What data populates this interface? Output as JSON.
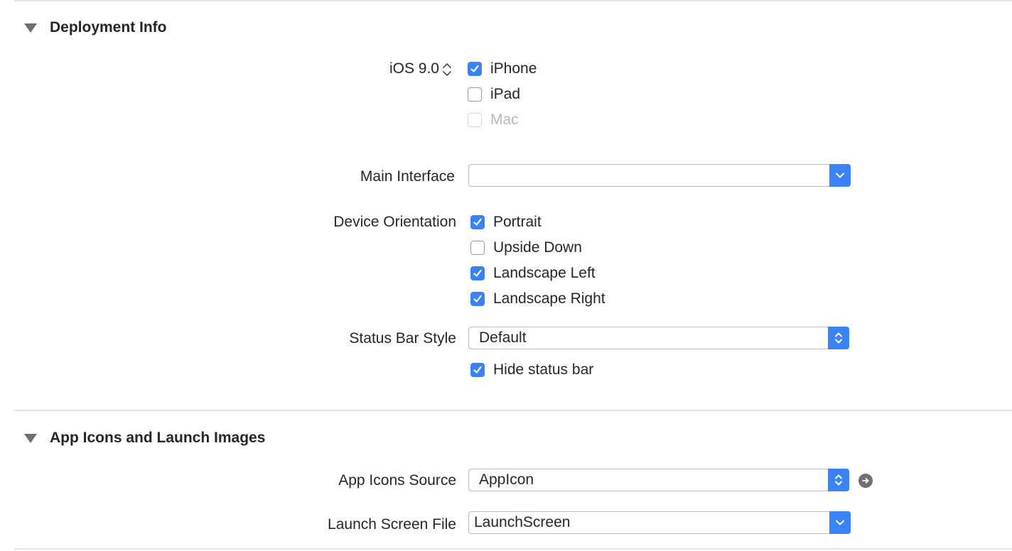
{
  "deployment": {
    "title": "Deployment Info",
    "ios_version": "iOS 9.0",
    "devices": [
      {
        "label": "iPhone",
        "checked": true,
        "enabled": true
      },
      {
        "label": "iPad",
        "checked": false,
        "enabled": true
      },
      {
        "label": "Mac",
        "checked": false,
        "enabled": false
      }
    ],
    "main_interface_label": "Main Interface",
    "main_interface_value": "",
    "orientation_label": "Device Orientation",
    "orientations": [
      {
        "label": "Portrait",
        "checked": true
      },
      {
        "label": "Upside Down",
        "checked": false
      },
      {
        "label": "Landscape Left",
        "checked": true
      },
      {
        "label": "Landscape Right",
        "checked": true
      }
    ],
    "status_bar_label": "Status Bar Style",
    "status_bar_value": "Default",
    "hide_status_bar_label": "Hide status bar",
    "hide_status_bar_checked": true
  },
  "app_icons": {
    "title": "App Icons and Launch Images",
    "icons_source_label": "App Icons Source",
    "icons_source_value": "AppIcon",
    "launch_screen_label": "Launch Screen File",
    "launch_screen_value": "LaunchScreen"
  },
  "colors": {
    "accent": "#3a82f7",
    "separator": "#e1e1e1",
    "text": "#262626",
    "disabled": "#b9b9b9"
  }
}
